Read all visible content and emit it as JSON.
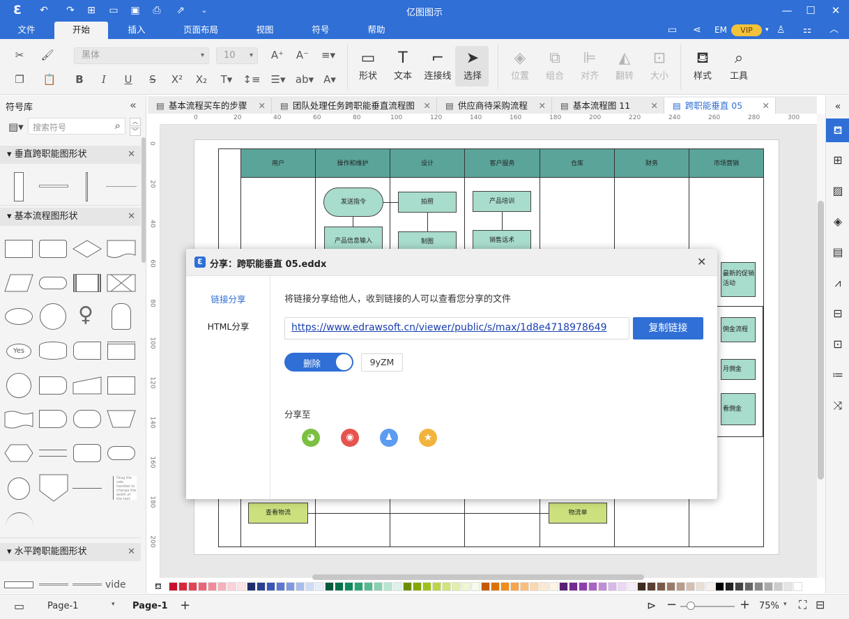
{
  "app": {
    "title": "亿图图示"
  },
  "menus": [
    "文件",
    "开始",
    "插入",
    "页面布局",
    "视图",
    "符号",
    "帮助"
  ],
  "user": {
    "initials": "EM",
    "vip": "VIP"
  },
  "toolbar": {
    "font_family": "黑体",
    "font_size": "10",
    "big_buttons": [
      "形状",
      "文本",
      "连接线",
      "选择",
      "位置",
      "组合",
      "对齐",
      "翻转",
      "大小",
      "样式",
      "工具"
    ]
  },
  "library": {
    "title": "符号库",
    "search_placeholder": "搜索符号",
    "sections": [
      "垂直跨职能图形状",
      "基本流程图形状",
      "水平跨职能图形状"
    ],
    "yes_label": "Yes",
    "note_text": "Drag the side handles to change the width of the text block.",
    "partial_label": "vide"
  },
  "tabs": [
    "基本流程买车的步骤",
    "团队处理任务跨职能垂直流程图",
    "供应商待采购流程",
    "基本流程图 11",
    "跨职能垂直 05"
  ],
  "ruler": {
    "h": [
      "0",
      "20",
      "40",
      "60",
      "80",
      "100",
      "120",
      "140",
      "160",
      "180",
      "200",
      "220",
      "240",
      "260",
      "280",
      "300"
    ],
    "v": [
      "0",
      "20",
      "40",
      "60",
      "80",
      "100",
      "120",
      "140",
      "160",
      "180",
      "200"
    ]
  },
  "diagram": {
    "lanes": [
      "用户",
      "操作和维护",
      "设计",
      "客户服务",
      "仓库",
      "财务",
      "市场营销"
    ],
    "boxes": [
      "发送指令",
      "产品信息输入",
      "拍照",
      "制图",
      "产品培训",
      "销售话术",
      "最新的促销活动",
      "佣金流程",
      "月佣金",
      "看佣金",
      "查看物流",
      "物流单"
    ]
  },
  "dialog": {
    "title": "分享：跨职能垂直 05.eddx",
    "nav": [
      "链接分享",
      "HTML分享"
    ],
    "description": "将链接分享给他人，收到链接的人可以查看您分享的文件",
    "link": "https://www.edrawsoft.cn/viewer/public/s/max/1d8e4718978649",
    "copy_button": "复制链接",
    "toggle_label": "删除",
    "code": "9yZM",
    "share_to": "分享至"
  },
  "status": {
    "page_dropdown": "Page-1",
    "page_tab": "Page-1",
    "zoom": "75%"
  },
  "colors": {
    "brand": "#2f6fd6",
    "lane_header": "#5ba49a",
    "box": "#a8dccd",
    "box_green": "#cce07d",
    "wechat": "#7bc043",
    "weibo": "#e6534d",
    "qq": "#5b9cf0",
    "fav": "#f2b33d"
  }
}
